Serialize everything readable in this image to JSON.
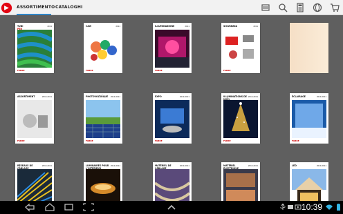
{
  "app": {
    "icon": "app-logo-icon"
  },
  "tabs": [
    {
      "label": "ASSORTIMENTO",
      "active": true
    },
    {
      "label": "CATALOGHI",
      "active": false
    }
  ],
  "toolbar_icons": [
    "scan-icon",
    "search-icon",
    "calculator-icon",
    "globe-icon",
    "cart-icon"
  ],
  "catalogs": [
    {
      "title": "TUBI",
      "subtitle": "PER CANALIZZAZIONE",
      "year": "2011",
      "cover": "tubes"
    },
    {
      "title": "CAVI",
      "year": "2011",
      "cover": "cables"
    },
    {
      "title": "ILLUMINAZIONE",
      "year": "2011",
      "cover": "lighting"
    },
    {
      "title": "SICUREZZA",
      "year": "2011",
      "cover": "security"
    },
    {
      "title": "",
      "year": "",
      "cover": "blank"
    },
    {
      "title": "ASSORTIMENT",
      "year": "2010-2011",
      "cover": "assortment"
    },
    {
      "title": "PHOTOVOLTAÏQUE",
      "year": "2010-2011",
      "cover": "photovoltaic"
    },
    {
      "title": "EXPO",
      "year": "2010-2011",
      "cover": "expo"
    },
    {
      "title": "ILLUMINATIONS DE NOËL",
      "year": "2010-2011",
      "cover": "christmas"
    },
    {
      "title": "ÉCLAIRAGE",
      "year": "2010-2011",
      "cover": "lighting2"
    },
    {
      "title": "RÉSEAUX DE CÂBLAGE",
      "year": "2010-2011",
      "cover": "network"
    },
    {
      "title": "LUMINAIRES POUR L'INTÉRIEUR",
      "year": "2010-2011",
      "cover": "interior"
    },
    {
      "title": "MATÉRIEL DE CÂBLAGE",
      "year": "2010-2011",
      "cover": "wiring"
    },
    {
      "title": "MATÉRIEL ÉLECTRIQUE",
      "year": "2010-2011",
      "cover": "electric"
    },
    {
      "title": "LED",
      "year": "2010-2011",
      "cover": "led"
    }
  ],
  "brand": "FABRE",
  "navbar": {
    "buttons": [
      "back-icon",
      "home-icon",
      "recent-apps-icon",
      "screenshot-icon",
      "up-icon"
    ],
    "clock": "10:39"
  }
}
